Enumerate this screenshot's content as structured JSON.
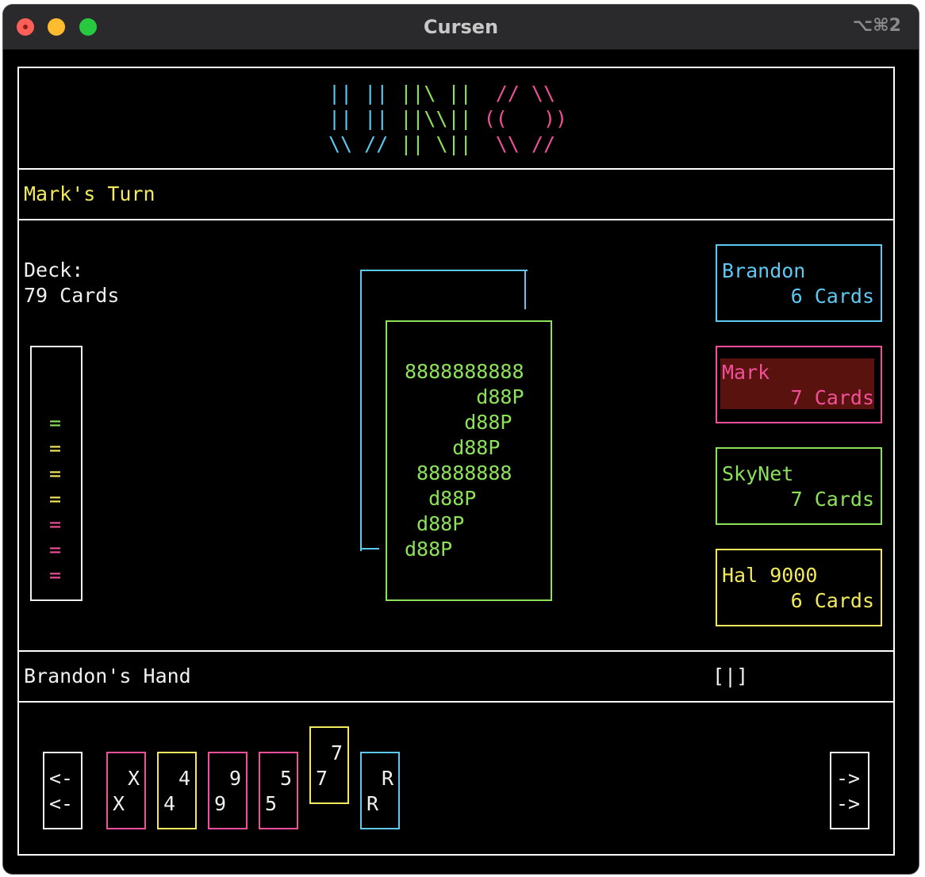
{
  "window": {
    "title": "Cursen",
    "shortcut": "⌥⌘2"
  },
  "logo": {
    "uno_lines": [
      "|| || ||\\ ||",
      "|| || ||\\\\||",
      "\\\\ // || \\||"
    ],
    "o_lines": [
      "// \\\\",
      "((   ))",
      "\\\\ //"
    ],
    "colors": {
      "u": "#5ec8f0",
      "n": "#8de25a",
      "o": "#f0509a"
    }
  },
  "turn_text": "Mark's Turn",
  "deck": {
    "label": "Deck:",
    "count_text": "79 Cards"
  },
  "discard_meter": {
    "marks": [
      {
        "char": "=",
        "color": "#8de25a"
      },
      {
        "char": "=",
        "color": "#f2ea5c"
      },
      {
        "char": "=",
        "color": "#f2ea5c"
      },
      {
        "char": "=",
        "color": "#f2ea5c"
      },
      {
        "char": "=",
        "color": "#f0509a"
      },
      {
        "char": "=",
        "color": "#f0509a"
      },
      {
        "char": "=",
        "color": "#f0509a"
      }
    ]
  },
  "top_card": {
    "color": "#8de25a",
    "art_lines": [
      "8888888888",
      "      d88P",
      "     d88P",
      "    d88P",
      " 88888888",
      "  d88P",
      " d88P",
      "d88P"
    ]
  },
  "players": [
    {
      "name": "Brandon",
      "cards_text": "6 Cards",
      "color": "#5ec8f0",
      "active": false
    },
    {
      "name": "Mark",
      "cards_text": "7 Cards",
      "color": "#f0509a",
      "active": true
    },
    {
      "name": "SkyNet",
      "cards_text": "7 Cards",
      "color": "#8de25a",
      "active": false
    },
    {
      "name": "Hal 9000",
      "cards_text": "6 Cards",
      "color": "#f2ea5c",
      "active": false
    }
  ],
  "hand": {
    "label": "Brandon's Hand",
    "indicator": "[|]",
    "prev_button": {
      "line1": "<-",
      "line2": "<-"
    },
    "next_button": {
      "line1": "->",
      "line2": "->"
    },
    "cards": [
      {
        "top": "X",
        "bottom": "X",
        "color": "#f0509a",
        "selected": false
      },
      {
        "top": "4",
        "bottom": "4",
        "color": "#f2ea5c",
        "selected": false
      },
      {
        "top": "9",
        "bottom": "9",
        "color": "#f0509a",
        "selected": false
      },
      {
        "top": "5",
        "bottom": "5",
        "color": "#f0509a",
        "selected": false
      },
      {
        "top": "7",
        "bottom": "7",
        "color": "#f2ea5c",
        "selected": true
      },
      {
        "top": "R",
        "bottom": "R",
        "color": "#5ec8f0",
        "selected": false
      }
    ]
  }
}
